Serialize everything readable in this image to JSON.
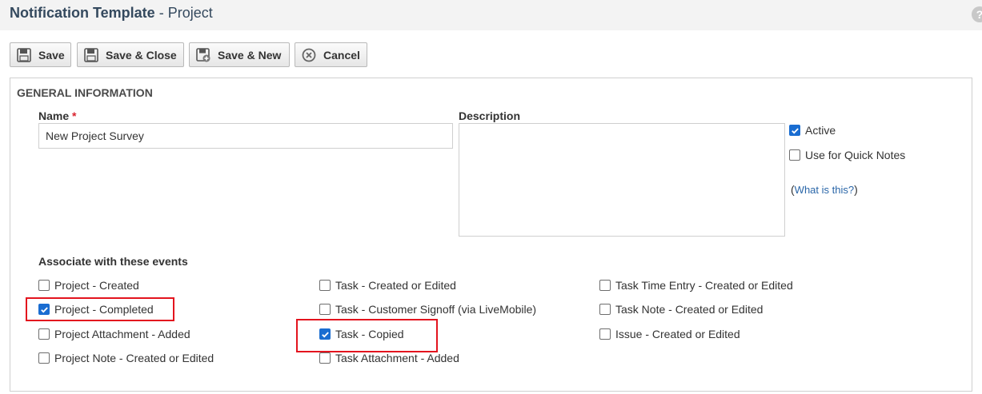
{
  "header": {
    "title_main": "Notification Template",
    "title_sep": " - ",
    "title_sub": "Project",
    "help_glyph": "?"
  },
  "toolbar": {
    "save_label": "Save",
    "save_close_label": "Save & Close",
    "save_new_label": "Save & New",
    "cancel_label": "Cancel"
  },
  "general": {
    "section_title": "GENERAL INFORMATION",
    "name_label": "Name",
    "required_mark": "*",
    "name_value": "New Project Survey",
    "description_label": "Description",
    "description_value": "",
    "active_label": "Active",
    "active_checked": true,
    "quick_notes_label": "Use for Quick Notes",
    "quick_notes_checked": false,
    "help_open": "(",
    "help_link": "What is this?",
    "help_close": ")"
  },
  "events": {
    "title": "Associate with these events",
    "columns": [
      [
        {
          "label": "Project - Created",
          "checked": false
        },
        {
          "label": "Project - Completed",
          "checked": true
        },
        {
          "label": "Project Attachment - Added",
          "checked": false
        },
        {
          "label": "Project Note - Created or Edited",
          "checked": false
        }
      ],
      [
        {
          "label": "Task - Created or Edited",
          "checked": false
        },
        {
          "label": "Task - Customer Signoff (via LiveMobile)",
          "checked": false
        },
        {
          "label": "Task - Copied",
          "checked": true
        },
        {
          "label": "Task Attachment - Added",
          "checked": false
        }
      ],
      [
        {
          "label": "Task Time Entry - Created or Edited",
          "checked": false
        },
        {
          "label": "Task Note - Created or Edited",
          "checked": false
        },
        {
          "label": "Issue - Created or Edited",
          "checked": false
        }
      ]
    ]
  },
  "colors": {
    "accent": "#1a6dd1",
    "highlight": "#e3141e",
    "link": "#2a66a8"
  }
}
